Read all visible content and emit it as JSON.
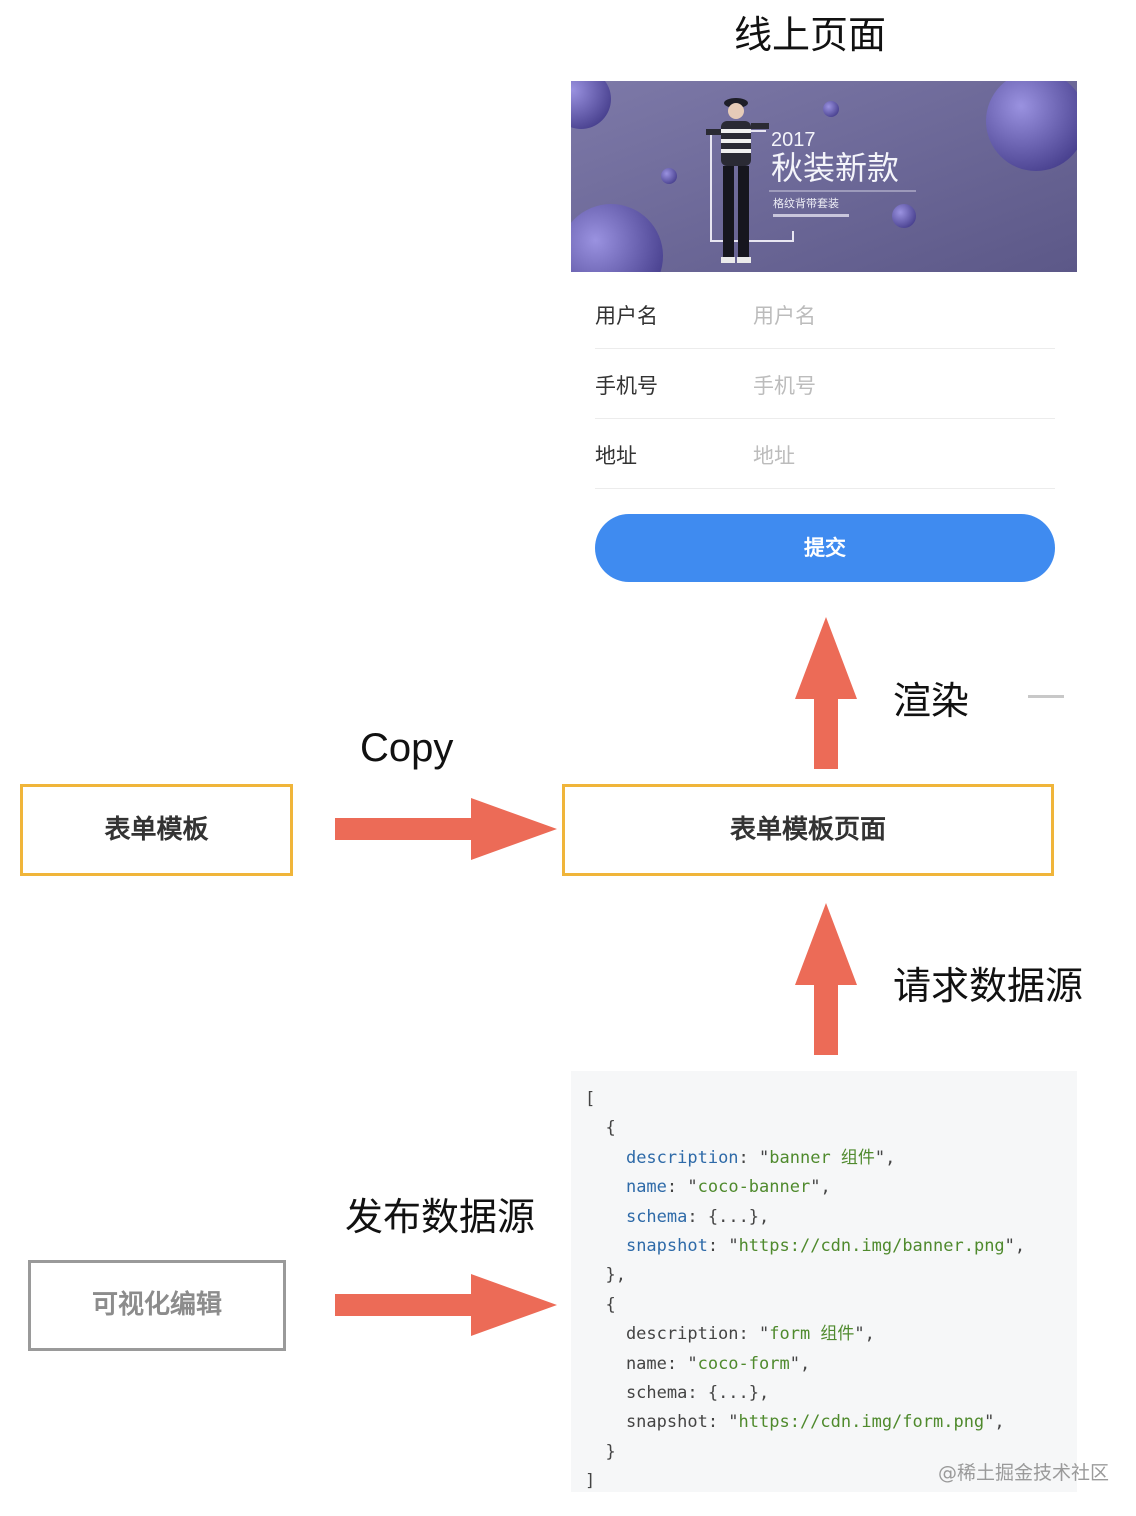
{
  "page": {
    "title": "线上页面"
  },
  "banner": {
    "year": "2017",
    "headline": "秋装新款",
    "subline": "格纹背带套装"
  },
  "form": {
    "fields": [
      {
        "label": "用户名",
        "placeholder": "用户名"
      },
      {
        "label": "手机号",
        "placeholder": "手机号"
      },
      {
        "label": "地址",
        "placeholder": "地址"
      }
    ],
    "submit_label": "提交"
  },
  "flow": {
    "render_label": "渲染",
    "copy_label": "Copy",
    "request_label": "请求数据源",
    "publish_label": "发布数据源",
    "template_box": "表单模板",
    "template_page_box": "表单模板页面",
    "editor_box": "可视化编辑"
  },
  "data_source": {
    "items": [
      {
        "description": "banner 组件",
        "name": "coco-banner",
        "schema": "{...}",
        "snapshot": "https://cdn.img/banner.png"
      },
      {
        "description": "form 组件",
        "name": "coco-form",
        "schema": "{...}",
        "snapshot": "https://cdn.img/form.png"
      }
    ]
  },
  "watermark": "@稀土掘金技术社区",
  "colors": {
    "arrow": "#ec6b57",
    "box_border": "#f0b53a",
    "editor_border": "#9a9a9a",
    "submit": "#3f8bf0",
    "banner_bg": "#6b6796"
  }
}
